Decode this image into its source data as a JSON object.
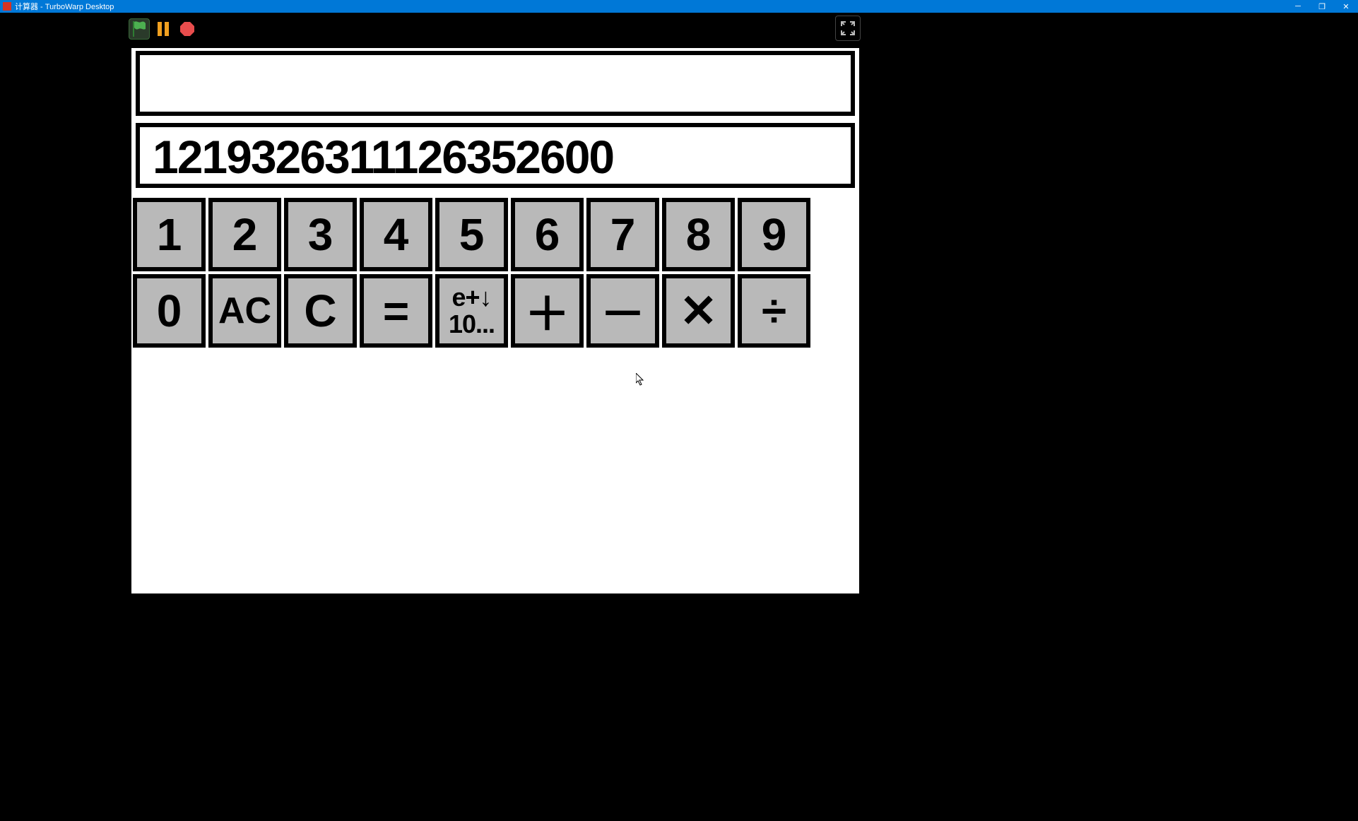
{
  "window": {
    "title": "计算器 - TurboWarp Desktop",
    "minimize": "─",
    "maximize": "❐",
    "close": "✕"
  },
  "toolbar": {
    "green_flag": "green-flag",
    "pause": "pause",
    "stop": "stop",
    "fullscreen": "fullscreen"
  },
  "display": {
    "upper": "",
    "lower": "1219326311126352600"
  },
  "keys_row1": [
    "1",
    "2",
    "3",
    "4",
    "5",
    "6",
    "7",
    "8",
    "9"
  ],
  "keys_row2_plain": {
    "k0": "0",
    "ac": "AC",
    "c": "C",
    "eq": "=",
    "sci_top": "e+↓",
    "sci_bot": "10...",
    "plus": "＋",
    "minus": "－",
    "times": "✕",
    "divide": "÷"
  }
}
